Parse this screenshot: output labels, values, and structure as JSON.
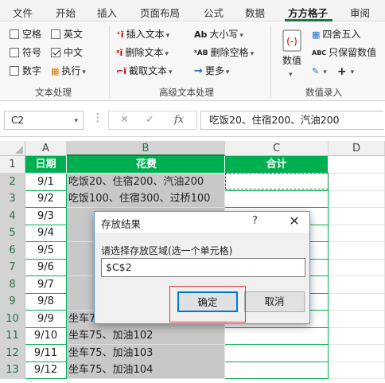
{
  "tabs": [
    "文件",
    "开始",
    "插入",
    "页面布局",
    "公式",
    "数据",
    "方方格子",
    "审阅"
  ],
  "active_tab": "方方格子",
  "ribbon": {
    "text_processing": {
      "label": "文本处理",
      "checkboxes": [
        {
          "label": "空格",
          "checked": false
        },
        {
          "label": "英文",
          "checked": false
        },
        {
          "label": "符号",
          "checked": false
        },
        {
          "label": "中文",
          "checked": true
        },
        {
          "label": "数字",
          "checked": false
        }
      ],
      "execute_label": "执行"
    },
    "advanced_text": {
      "label": "高级文本处理",
      "insert_text": "插入文本",
      "delete_text": "删除文本",
      "extract_text": "截取文本",
      "case": "大小写",
      "delete_spaces": "删除空格",
      "more": "更多"
    },
    "numeric_entry": {
      "label": "数值录入",
      "numeric": "数值",
      "round": "四舍五入",
      "keep_display": "只保留数值"
    }
  },
  "formula_bar": {
    "name_box": "C2",
    "fx": "fx",
    "formula": "吃饭20、住宿200、汽油200"
  },
  "columns": [
    "A",
    "B",
    "C",
    "D"
  ],
  "rows": [
    {
      "n": "1",
      "a": "日期",
      "b": "花费",
      "c": "合计"
    },
    {
      "n": "2",
      "a": "9/1",
      "b": "吃饭20、住宿200、汽油200",
      "c": ""
    },
    {
      "n": "3",
      "a": "9/2",
      "b": "吃饭100、住宿300、过桥100",
      "c": ""
    },
    {
      "n": "4",
      "a": "9/3",
      "b": "",
      "c": ""
    },
    {
      "n": "5",
      "a": "9/4",
      "b": "",
      "c": ""
    },
    {
      "n": "6",
      "a": "9/5",
      "b": "",
      "c": ""
    },
    {
      "n": "7",
      "a": "9/6",
      "b": "",
      "c": ""
    },
    {
      "n": "8",
      "a": "9/7",
      "b": "",
      "c": ""
    },
    {
      "n": "9",
      "a": "9/8",
      "b": "",
      "c": ""
    },
    {
      "n": "10",
      "a": "9/9",
      "b": "坐车75、加油101",
      "c": ""
    },
    {
      "n": "11",
      "a": "9/10",
      "b": "坐车75、加油102",
      "c": ""
    },
    {
      "n": "12",
      "a": "9/11",
      "b": "坐车75、加油103",
      "c": ""
    },
    {
      "n": "13",
      "a": "9/12",
      "b": "坐车75、加油104",
      "c": ""
    }
  ],
  "dialog": {
    "title": "存放结果",
    "help": "?",
    "close": "✕",
    "prompt": "请选择存放区域(选一个单元格)",
    "input_value": "$C$2",
    "ok": "确定",
    "cancel": "取消"
  },
  "colors": {
    "accent": "#217346",
    "header_fill": "#00b050",
    "selection_gray": "#c8c8c8",
    "highlight": "#e53935"
  }
}
